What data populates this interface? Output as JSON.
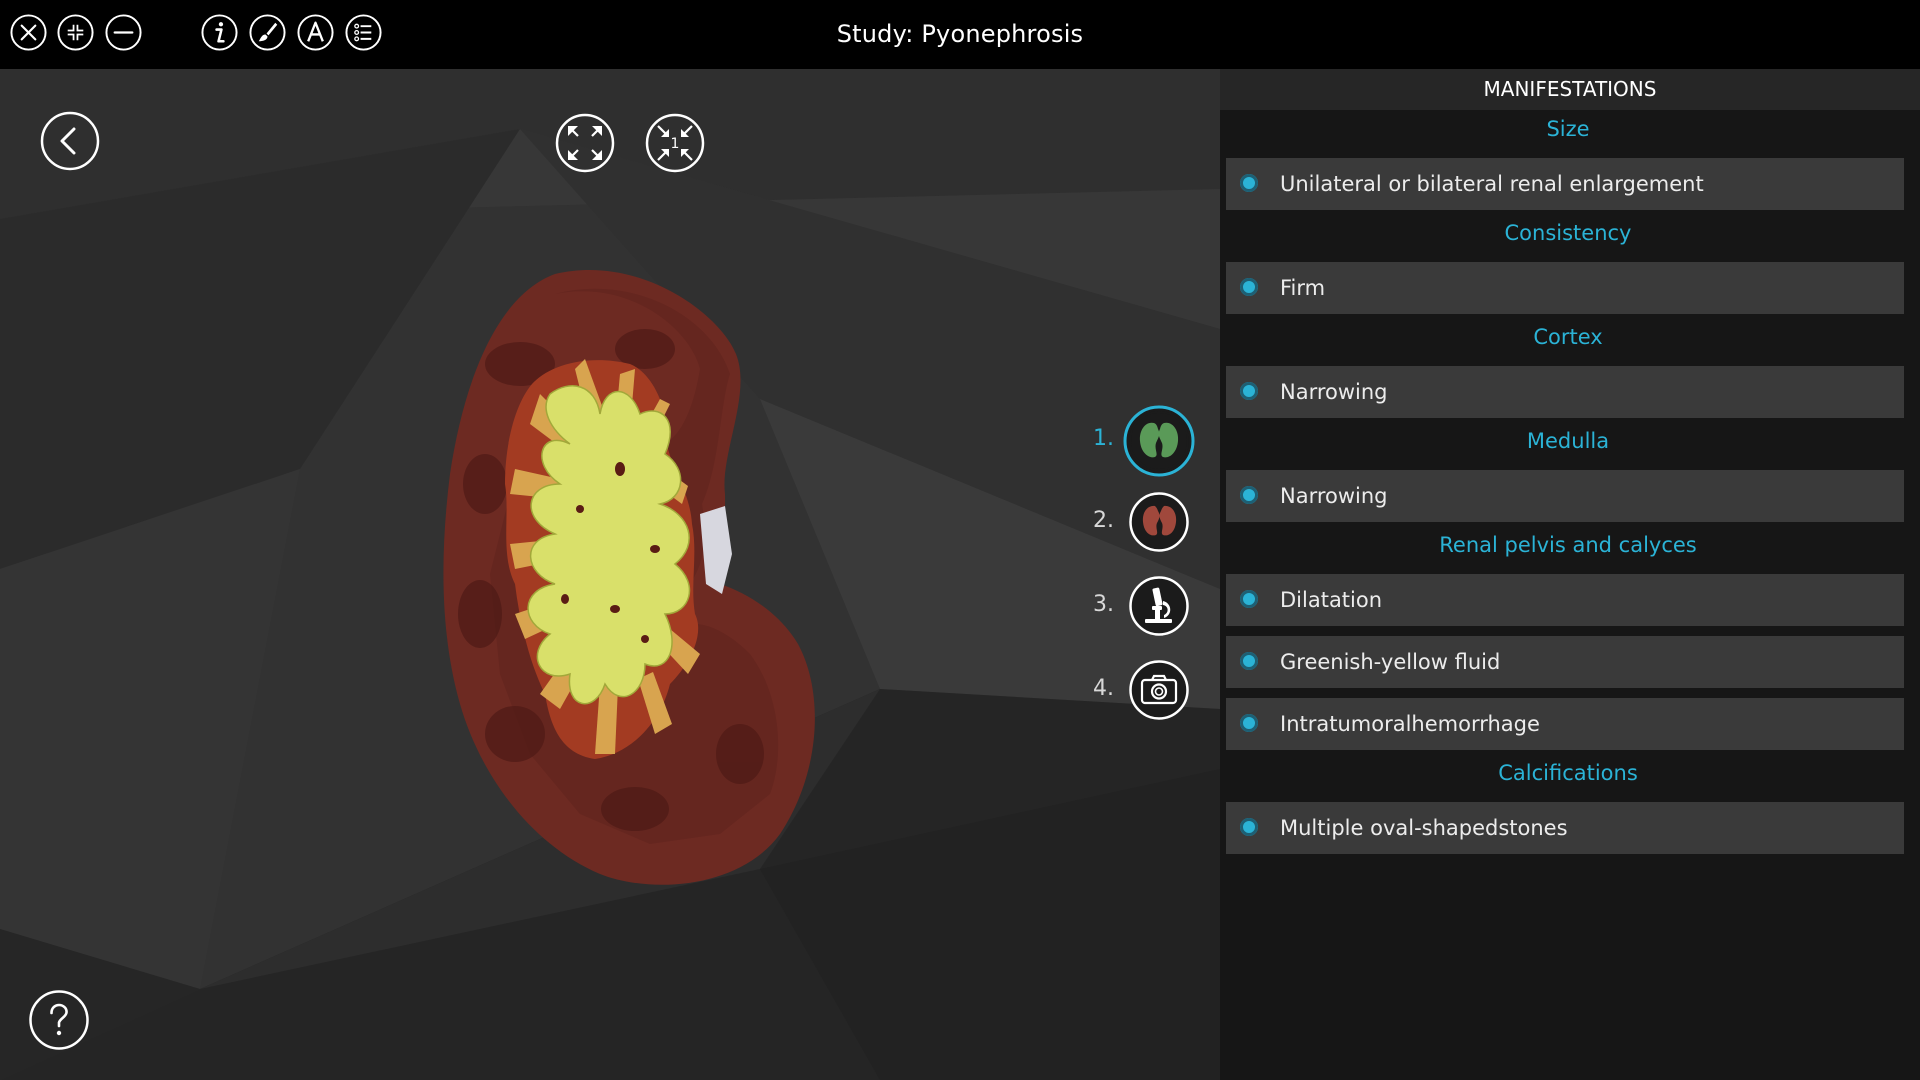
{
  "window": {
    "title": "Study: Pyonephrosis"
  },
  "toolbar": {
    "icons": [
      "close-icon",
      "collapse-icon",
      "minimize-icon",
      "info-icon",
      "brush-icon",
      "annotation-icon",
      "list-icon"
    ]
  },
  "viewer": {
    "buttons": [
      "back-icon",
      "expand-icon",
      "compress-icon",
      "help-icon"
    ],
    "compress_badge": "1",
    "steps": [
      {
        "number": "1.",
        "icon": "kidney-green-icon",
        "active": true
      },
      {
        "number": "2.",
        "icon": "kidney-red-icon",
        "active": false
      },
      {
        "number": "3.",
        "icon": "microscope-icon",
        "active": false
      },
      {
        "number": "4.",
        "icon": "camera-icon",
        "active": false
      }
    ]
  },
  "panel": {
    "title": "MANIFESTATIONS",
    "sections": [
      {
        "title": "Size",
        "items": [
          "Unilateral or bilateral renal enlargement"
        ]
      },
      {
        "title": "Consistency",
        "items": [
          "Firm"
        ]
      },
      {
        "title": "Cortex",
        "items": [
          "Narrowing"
        ]
      },
      {
        "title": "Medulla",
        "items": [
          "Narrowing"
        ]
      },
      {
        "title": "Renal pelvis and calyces",
        "items": [
          "Dilatation",
          "Greenish-yellow fluid",
          "Intratumoralhemorrhage"
        ]
      },
      {
        "title": "Calcifications",
        "items": [
          "Multiple oval-shapedstones"
        ]
      }
    ]
  },
  "colors": {
    "accent": "#2bb3d6",
    "panel_bg": "#161616",
    "row_bg": "#3a3a3a",
    "topbar_bg": "#000000"
  }
}
